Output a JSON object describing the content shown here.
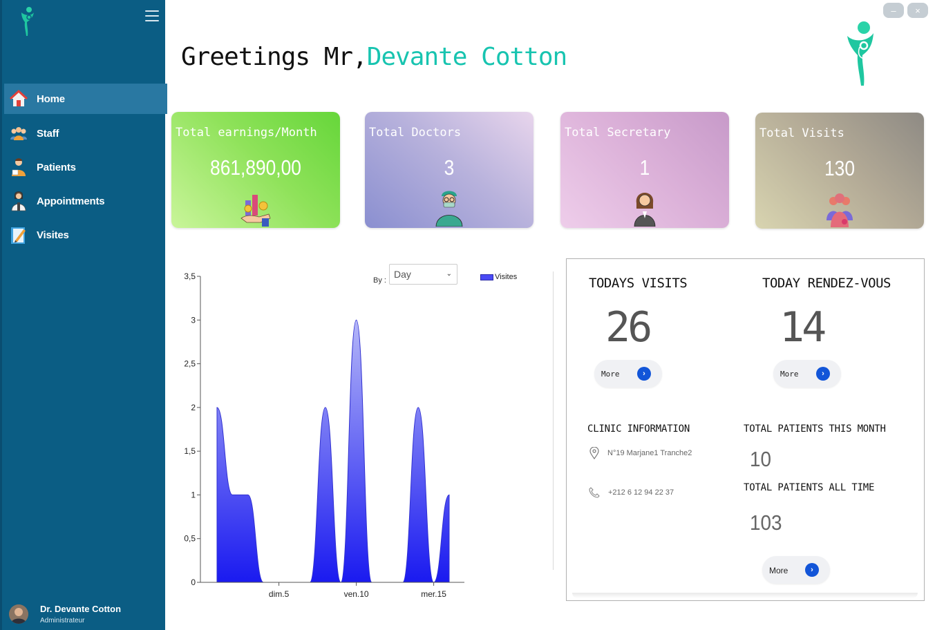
{
  "sidebar": {
    "items": [
      {
        "label": "Home",
        "icon": "home-icon",
        "active": true
      },
      {
        "label": "Staff",
        "icon": "staff-icon"
      },
      {
        "label": "Patients",
        "icon": "patient-icon"
      },
      {
        "label": "Appointments",
        "icon": "appointment-icon"
      },
      {
        "label": "Visites",
        "icon": "notebook-icon"
      }
    ],
    "user": {
      "name": "Dr. Devante Cotton",
      "role": "Administrateur"
    }
  },
  "window": {
    "minimize": "–",
    "close": "×"
  },
  "greeting": {
    "prefix": "Greetings Mr,",
    "name": "Devante Cotton"
  },
  "cards": [
    {
      "title": "Total earnings/Month",
      "value": "861,890,00",
      "icon": "money-icon"
    },
    {
      "title": "Total Doctors",
      "value": "3",
      "icon": "doctor-icon"
    },
    {
      "title": "Total Secretary",
      "value": "1",
      "icon": "secretary-icon"
    },
    {
      "title": "Total Visits",
      "value": "130",
      "icon": "visitors-icon"
    }
  ],
  "filter": {
    "by_label": "By :",
    "selected": "Day"
  },
  "chart_data": {
    "type": "area",
    "x": [
      1,
      2,
      3,
      4,
      5,
      6,
      7,
      8,
      9,
      10,
      11,
      12,
      13,
      14,
      15,
      16
    ],
    "series": [
      {
        "name": "Visites",
        "values": [
          2,
          1,
          1,
          0,
          0,
          0,
          0,
          2,
          0,
          3,
          0,
          0,
          0,
          2,
          0,
          1
        ]
      }
    ],
    "xticks": [
      {
        "x": 5,
        "label": "dim.5"
      },
      {
        "x": 10,
        "label": "ven.10"
      },
      {
        "x": 15,
        "label": "mer.15"
      }
    ],
    "yticks": [
      "0",
      "0,5",
      "1",
      "1,5",
      "2",
      "2,5",
      "3",
      "3,5"
    ],
    "ylim": [
      0,
      3.5
    ],
    "legend": "top-right",
    "color": "#3a3af0"
  },
  "panel": {
    "todays_visits_label": "TODAYS VISITS",
    "todays_visits": "26",
    "today_rdv_label": "TODAY RENDEZ-VOUS",
    "today_rdv": "14",
    "more": "More",
    "clinic_label": "CLINIC INFORMATION",
    "address": "N°19 Marjane1 Tranche2",
    "phone": "+212 6 12 94 22 37",
    "patients_month_label": "TOTAL PATIENTS THIS MONTH",
    "patients_month": "10",
    "patients_all_label": "TOTAL PATIENTS ALL TIME",
    "patients_all": "103"
  },
  "colors": {
    "sidebar": "#0b5d84",
    "accent": "#18c4b0",
    "button_blue": "#1255d8"
  }
}
